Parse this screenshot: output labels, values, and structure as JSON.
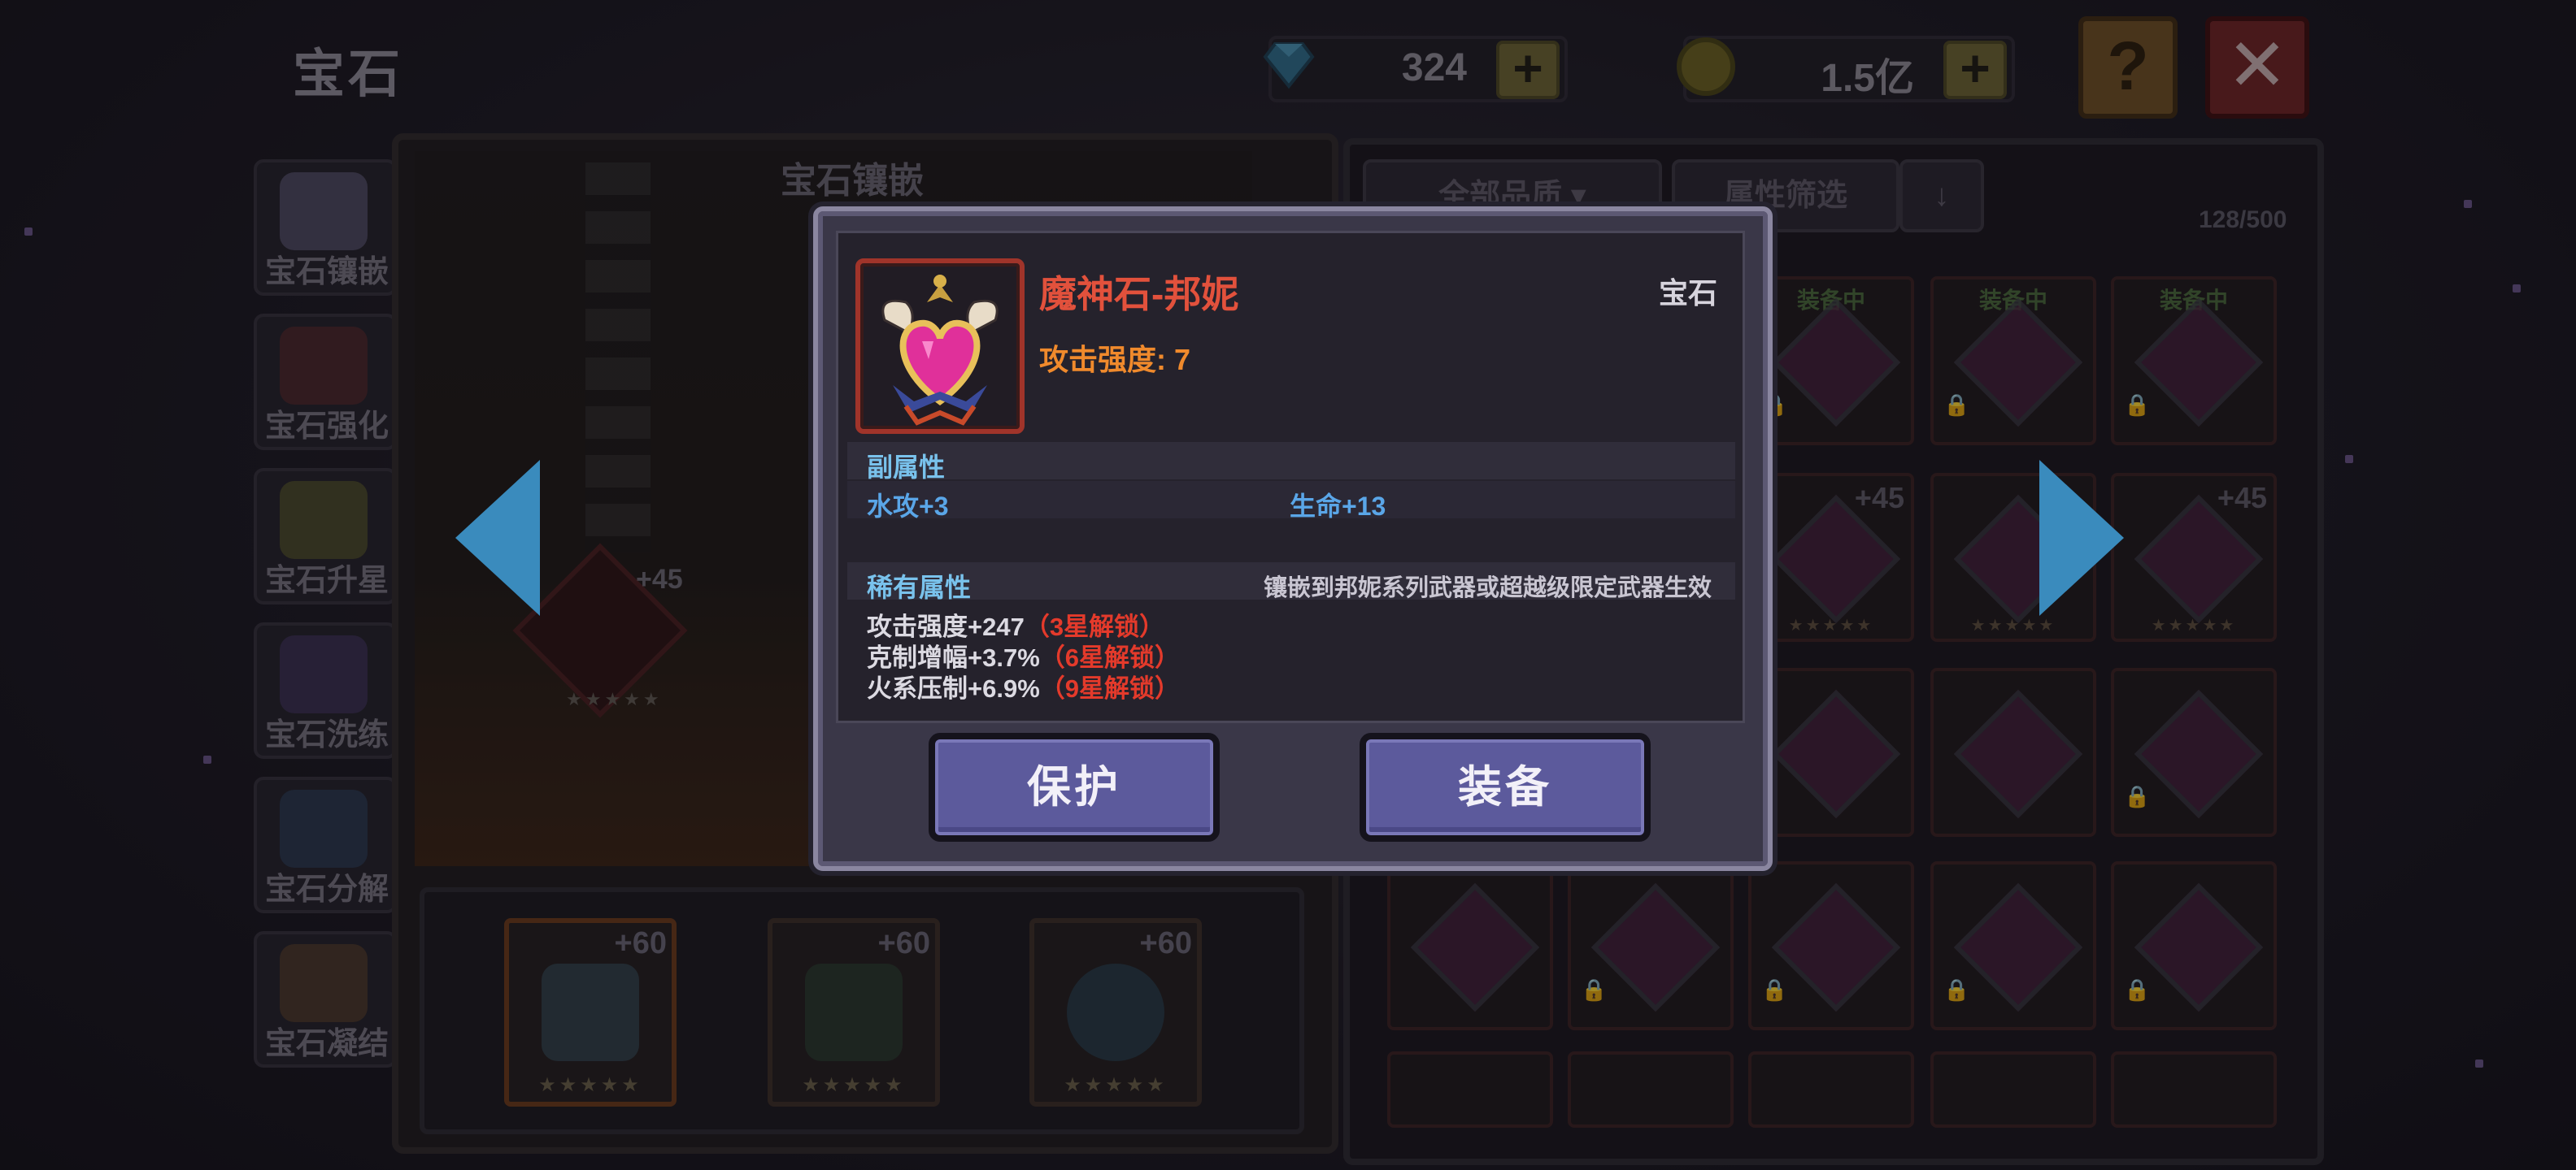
{
  "page_title": "宝石",
  "currency": {
    "gems": "324",
    "coins": "1.5亿"
  },
  "top_buttons": {
    "help": "?",
    "close": "✕"
  },
  "side_nav": [
    "宝石镶嵌",
    "宝石强化",
    "宝石升星",
    "宝石洗练",
    "宝石分解",
    "宝石凝结"
  ],
  "center": {
    "header": "宝石镶嵌",
    "socket_level": "+45",
    "socket_stars": "★★★★★",
    "equipment": [
      {
        "level": "+60",
        "stars": "★★★★★"
      },
      {
        "level": "+60",
        "stars": "★★★★★"
      },
      {
        "level": "+60",
        "stars": "★★★★★"
      }
    ]
  },
  "inventory": {
    "filter_quality": "全部品质",
    "filter_attr": "属性筛选",
    "sort_icon": "↓",
    "count": "128/500",
    "equipped_tag": "装备中",
    "row2_level": "+45",
    "stars": "★★★★★"
  },
  "modal": {
    "item_name": "魔神石-邦妮",
    "item_type": "宝石",
    "attack": "攻击强度: 7",
    "sub_title": "副属性",
    "sub_attrs": [
      "水攻+3",
      "生命+13"
    ],
    "rare_title": "稀有属性",
    "rare_note": "镶嵌到邦妮系列武器或超越级限定武器生效",
    "rare_attrs": [
      {
        "text": "攻击强度+247",
        "lock": "（3星解锁）"
      },
      {
        "text": "克制增幅+3.7%",
        "lock": "（6星解锁）"
      },
      {
        "text": "火系压制+6.9%",
        "lock": "（9星解锁）"
      }
    ],
    "btn_protect": "保护",
    "btn_equip": "装备"
  },
  "colors": {
    "accent_blue": "#79c2ec",
    "name_red": "#e2513c",
    "attack_orange": "#f08a2c",
    "lock_red": "#e43a2b",
    "button_purple": "#5c5a9c"
  },
  "icons": [
    "diamond-icon",
    "coin-icon",
    "plus-icon",
    "help-icon",
    "close-icon",
    "left-arrow-icon",
    "right-arrow-icon",
    "lock-icon",
    "gem-heart-icon"
  ]
}
